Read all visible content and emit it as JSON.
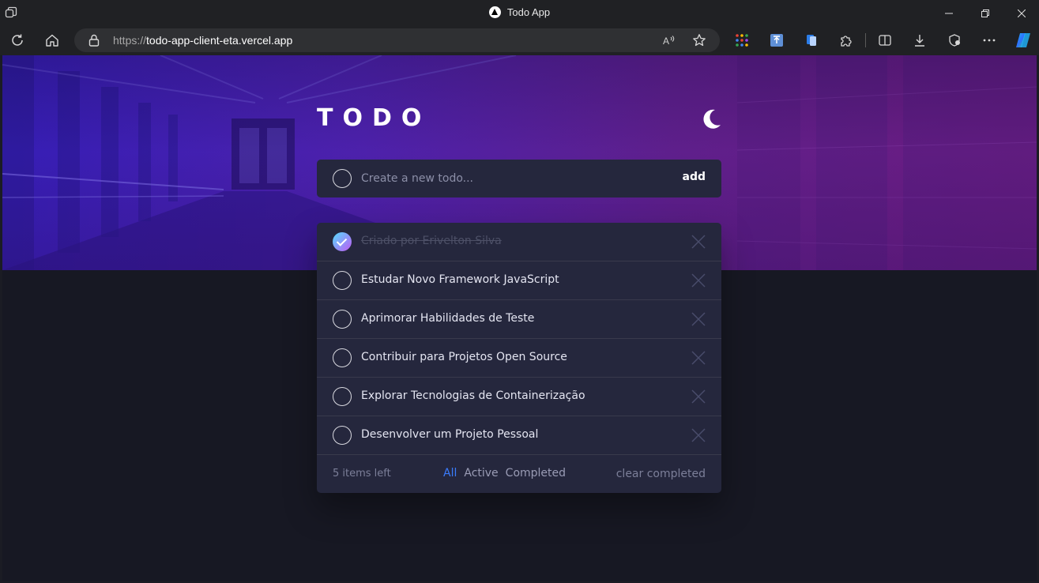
{
  "browser": {
    "tab_title": "Todo App",
    "url_protocol": "https://",
    "url_host": "todo-app-client-eta.vercel.app"
  },
  "app": {
    "title": "TODO",
    "input_placeholder": "Create a new todo...",
    "add_label": "add"
  },
  "todos": [
    {
      "text": "Criado por Erivelton Silva",
      "completed": true
    },
    {
      "text": "Estudar Novo Framework JavaScript",
      "completed": false
    },
    {
      "text": "Aprimorar Habilidades de Teste",
      "completed": false
    },
    {
      "text": "Contribuir para Projetos Open Source",
      "completed": false
    },
    {
      "text": "Explorar Tecnologias de Containerização",
      "completed": false
    },
    {
      "text": "Desenvolver um Projeto Pessoal",
      "completed": false
    }
  ],
  "footer": {
    "items_left": "5 items left",
    "filter_all": "All",
    "filter_active": "Active",
    "filter_completed": "Completed",
    "clear_completed": "clear completed"
  },
  "colors": {
    "accent": "#3a7cfd",
    "card": "#25273d",
    "background": "#171823"
  }
}
